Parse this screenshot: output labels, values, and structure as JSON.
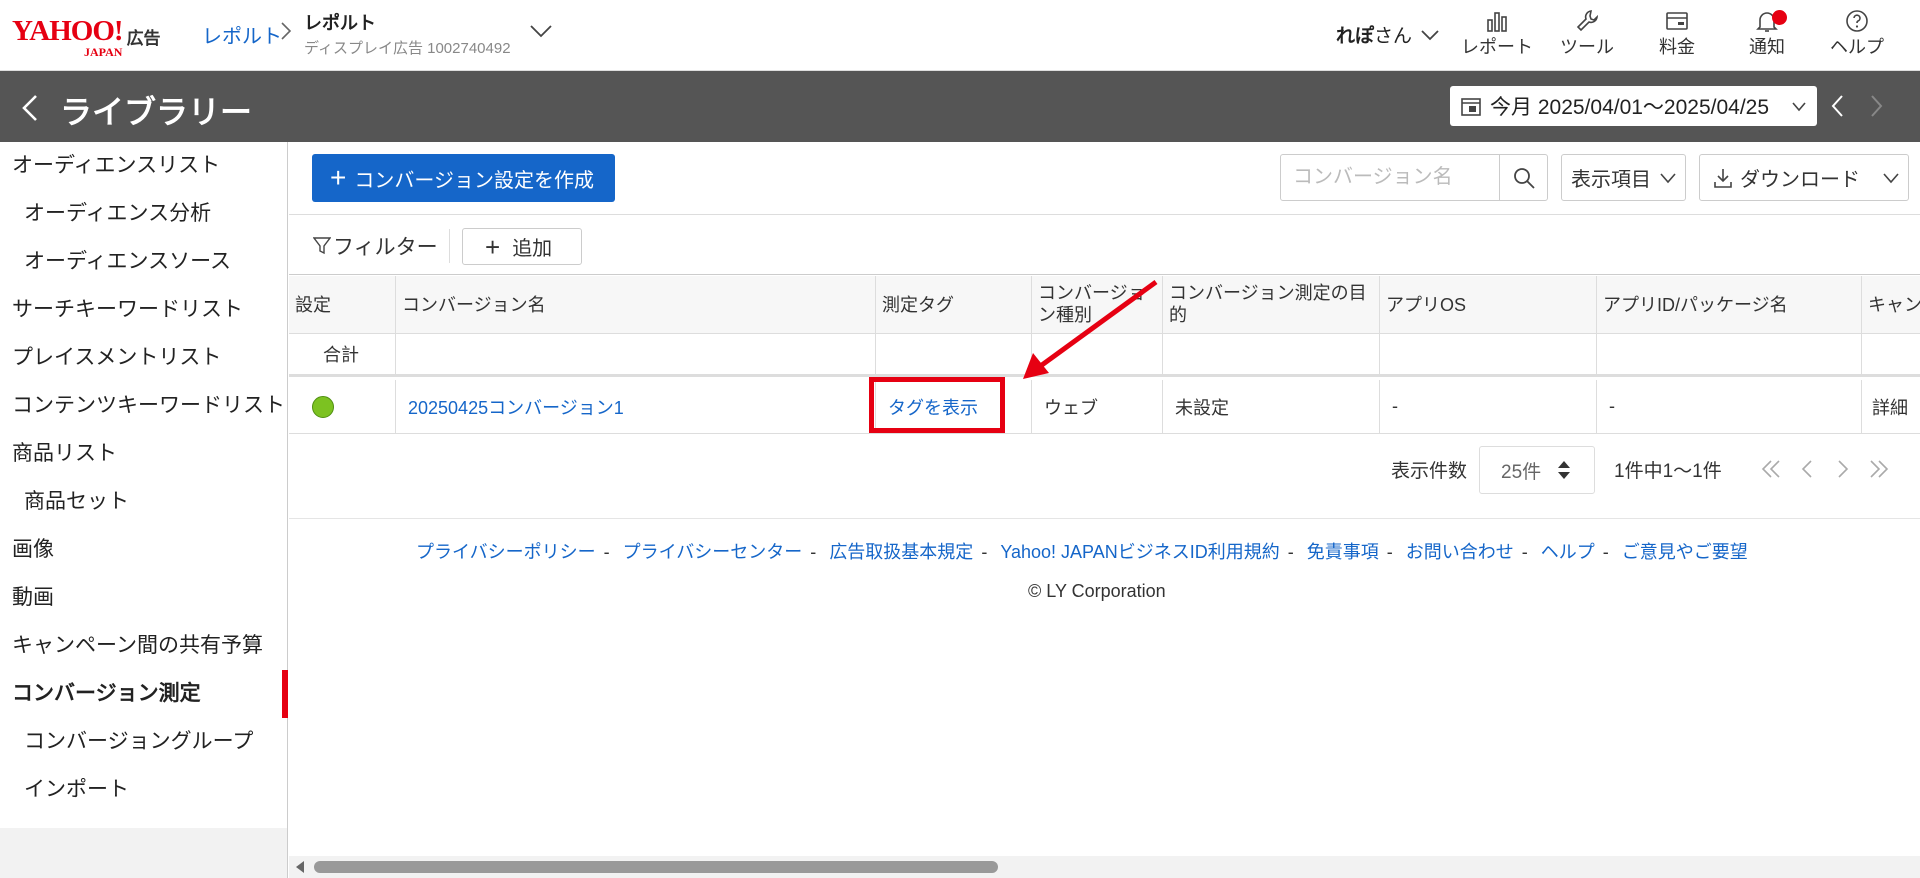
{
  "header": {
    "logo_text": "YAHOO!",
    "logo_sub": "JAPAN",
    "logo_ads": "広告",
    "breadcrumb_link": "レポルト",
    "account_name": "レポルト",
    "account_sub": "ディスプレイ広告 1002740492",
    "user_name": "れぽ",
    "user_suffix": "さん",
    "nav": [
      {
        "label": "レポート",
        "icon": "bar-chart-icon"
      },
      {
        "label": "ツール",
        "icon": "wrench-icon"
      },
      {
        "label": "料金",
        "icon": "billing-icon"
      },
      {
        "label": "通知",
        "icon": "bell-icon"
      },
      {
        "label": "ヘルプ",
        "icon": "help-icon"
      }
    ]
  },
  "titlebar": {
    "title": "ライブラリー",
    "date_range": "今月 2025/04/01〜2025/04/25"
  },
  "sidebar": {
    "items": [
      {
        "label": "オーディエンスリスト",
        "sub": false
      },
      {
        "label": "オーディエンス分析",
        "sub": true
      },
      {
        "label": "オーディエンスソース",
        "sub": true
      },
      {
        "label": "サーチキーワードリスト",
        "sub": false
      },
      {
        "label": "プレイスメントリスト",
        "sub": false
      },
      {
        "label": "コンテンツキーワードリスト",
        "sub": false
      },
      {
        "label": "商品リスト",
        "sub": false
      },
      {
        "label": "商品セット",
        "sub": true
      },
      {
        "label": "画像",
        "sub": false
      },
      {
        "label": "動画",
        "sub": false
      },
      {
        "label": "キャンペーン間の共有予算",
        "sub": false
      },
      {
        "label": "コンバージョン測定",
        "sub": false,
        "active": true
      },
      {
        "label": "コンバージョングループ",
        "sub": true
      },
      {
        "label": "インポート",
        "sub": true
      }
    ]
  },
  "toolbar": {
    "create_label": "コンバージョン設定を作成",
    "search_placeholder": "コンバージョン名",
    "columns_label": "表示項目",
    "download_label": "ダウンロード",
    "filter_label": "フィルター",
    "add_label": "追加"
  },
  "table": {
    "headers": [
      "設定",
      "コンバージョン名",
      "測定タグ",
      "コンバージョン種別",
      "コンバージョン測定の目的",
      "アプリOS",
      "アプリID/パッケージ名",
      "キャン"
    ],
    "total_label": "合計",
    "rows": [
      {
        "status": "active",
        "name": "20250425コンバージョン1",
        "tag": "タグを表示",
        "type": "ウェブ",
        "purpose": "未設定",
        "os": "-",
        "app_id": "-",
        "detail": "詳細"
      }
    ]
  },
  "pagination": {
    "per_page_label": "表示件数",
    "per_page_value": "25件",
    "range_text": "1件中1〜1件"
  },
  "footer": {
    "links": [
      "プライバシーポリシー",
      "プライバシーセンター",
      "広告取扱基本規定",
      "Yahoo! JAPANビジネスID利用規約",
      "免責事項",
      "お問い合わせ",
      "ヘルプ",
      "ご意見やご要望"
    ],
    "copyright": "© LY Corporation"
  },
  "colors": {
    "brand_red": "#e60012",
    "link_blue": "#1566c9",
    "title_bar": "#555555",
    "status_green": "#7cc221"
  }
}
